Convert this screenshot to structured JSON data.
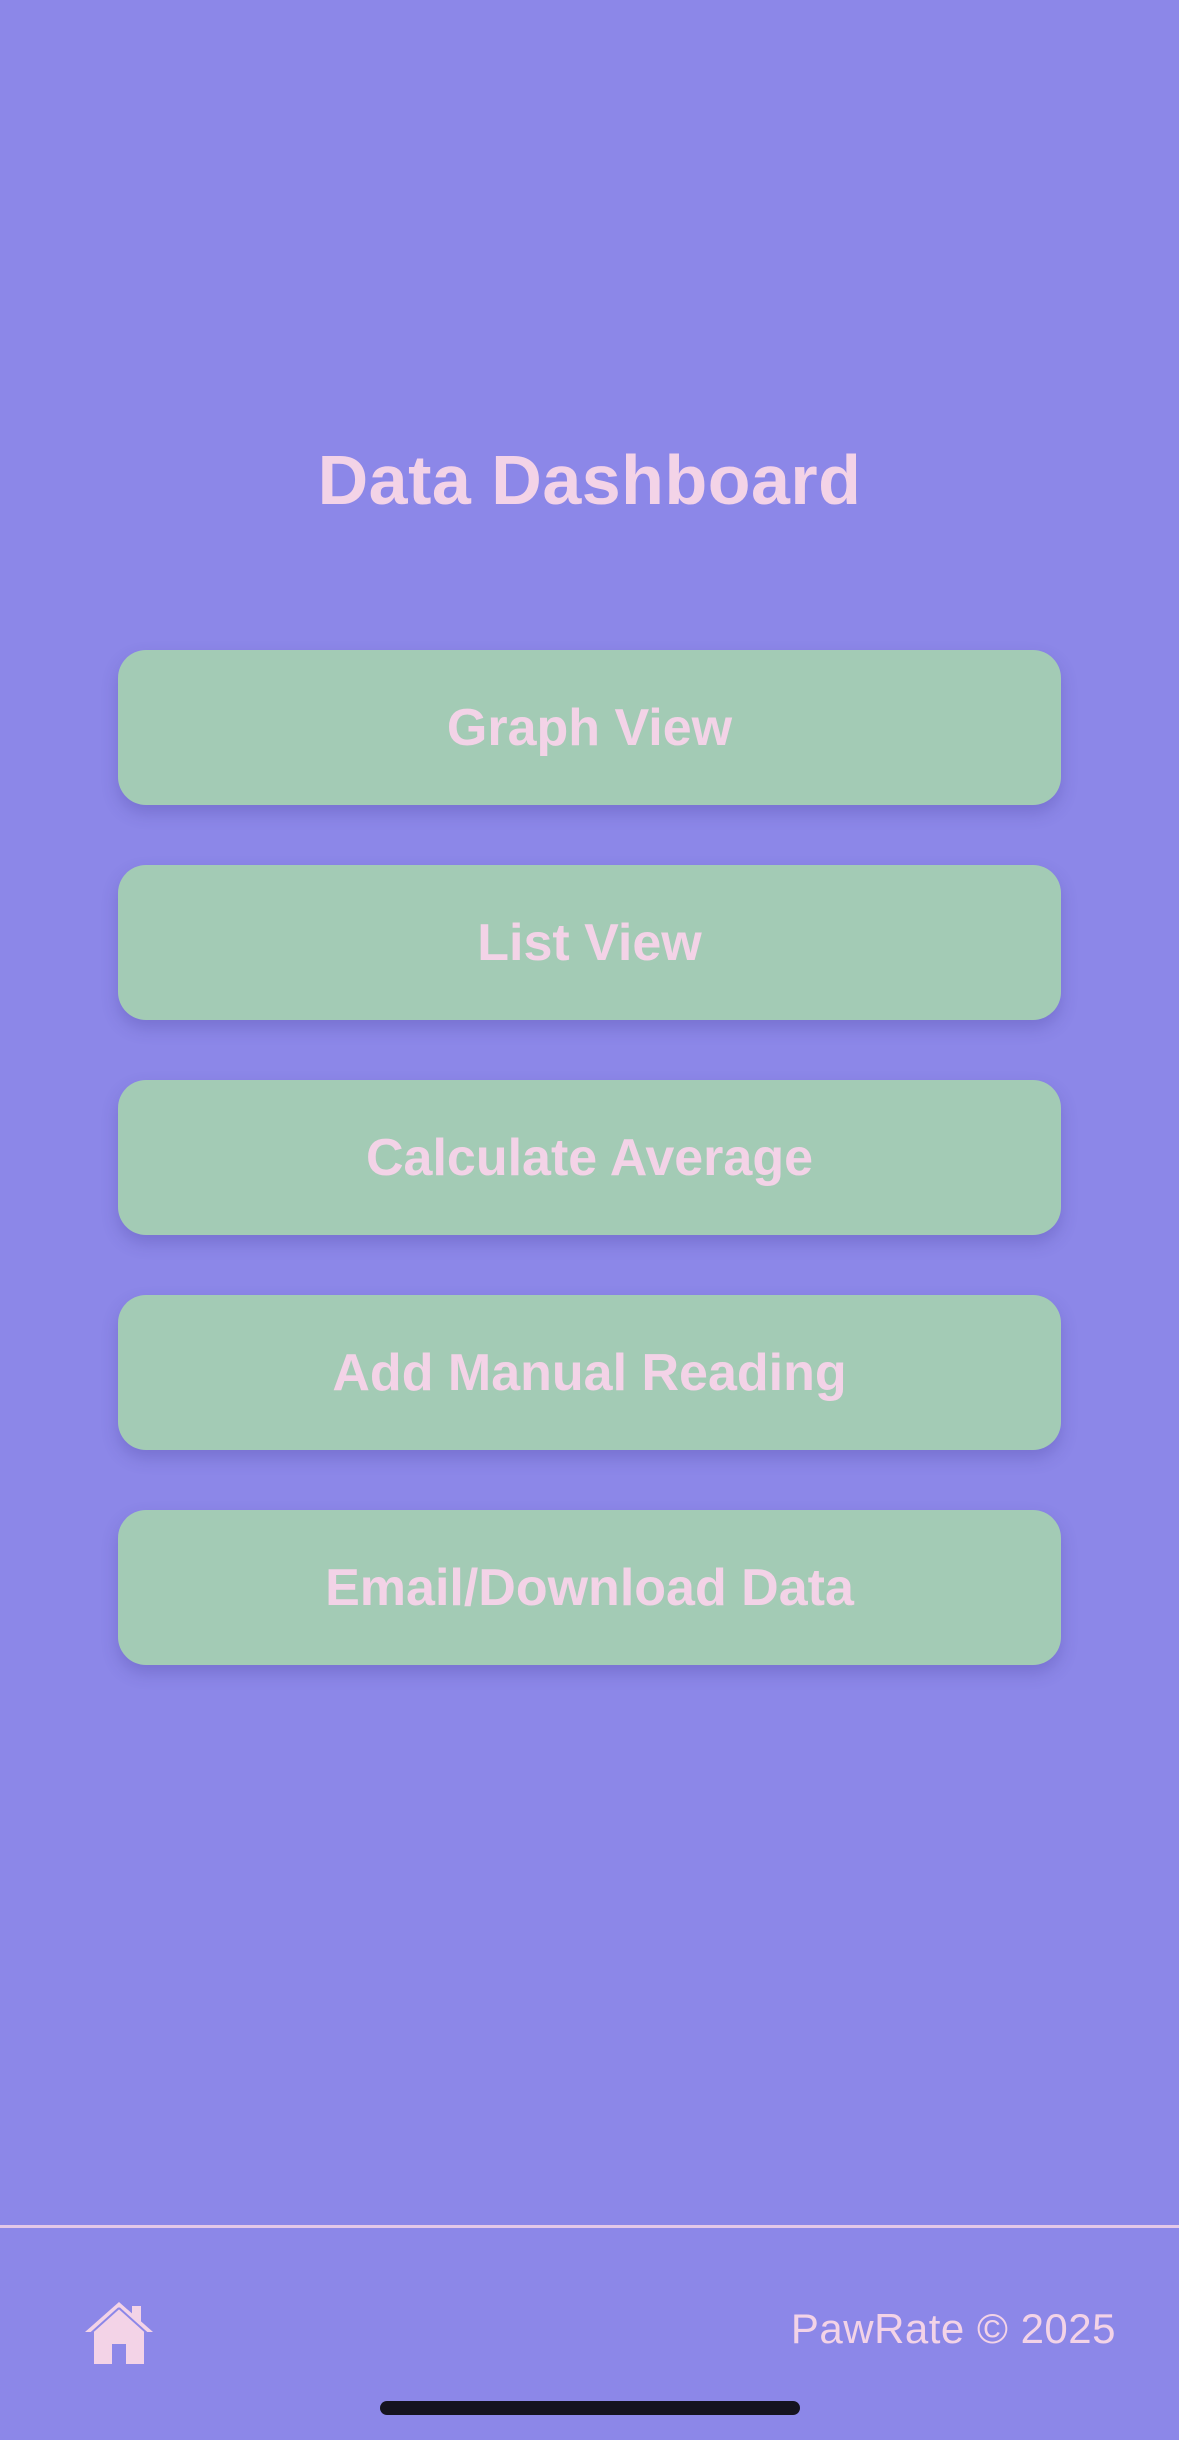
{
  "page": {
    "title": "Data Dashboard"
  },
  "menu": {
    "items": [
      {
        "label": "Graph View"
      },
      {
        "label": "List View"
      },
      {
        "label": "Calculate Average"
      },
      {
        "label": "Add Manual Reading"
      },
      {
        "label": "Email/Download Data"
      }
    ]
  },
  "footer": {
    "home_icon": "home-icon",
    "copyright": "PawRate © 2025"
  },
  "colors": {
    "background": "#8c87e8",
    "button": "#a3cbb5",
    "text": "#f3d3e7",
    "home_indicator": "#15131f"
  }
}
